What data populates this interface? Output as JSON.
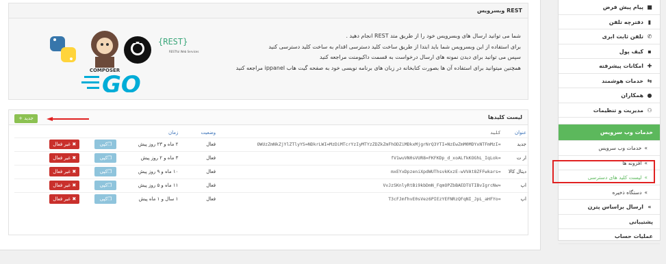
{
  "service_panel": {
    "title": "وبسرویس REST",
    "lines": [
      "شما می توانید ارسال های وبسرویس خود را از طریق متد REST انجام دهید .",
      "برای استفاده از این وبسرویس شما باید ابتدا از طریق ساخت کلید دسترسی اقدام به ساخت کلید دسترسی کنید",
      "سپس می توانید برای دیدن نمونه های ارسال درخواست به قسمت داکیومنت مراجعه کنید",
      "همچنین میتوانید برای استفاده آن ها بصورت کتابخانه در زبان های برنامه نویسی خود به صفحه گیت هاب ippanel مراجعه کنید"
    ],
    "logos": {
      "python": "python-logo",
      "composer": "COMPOSER",
      "github": "github-logo",
      "rest": "{REST}",
      "rest_sub": "RESTful Web Services",
      "go": "GO"
    }
  },
  "keys_panel": {
    "title": "لیست کلیدها",
    "add_label": "جدید",
    "columns": [
      "عنوان",
      "کلید",
      "وضعیت",
      "زمان",
      ""
    ],
    "rows": [
      {
        "name": "جدید",
        "key": "=OWUzZmNkZjYlZTlyYS=NDkrLWI=MzDiMTcrYzIyMTYzZDZkZmFhODZiMDkxMjgrNrQ3YTI=NzEwZmM0MDYxNTFmMzI",
        "status": "فعال",
        "time": "۲ ماه و ۲۳ روز پیش"
      },
      {
        "name": "ار ت",
        "key": "=fV1wuVN0sVUR8=FKFKDp_d_xoALfkKOGhL_IqLok",
        "status": "فعال",
        "time": "۳ ماه و ۲ روز پیش"
      },
      {
        "name": "دیتال کالا",
        "key": "=mxEYxDpzeniXpdWUThsvkKxzE-wVVAt8ZFFwkars",
        "status": "فعال",
        "time": "۱۰ ماه و ۹ روز پیش"
      },
      {
        "name": "اپ",
        "key": "=VvJzSKnlyRtBi9kbDmN_FqmOPZbBAEDTUTIBvIgrcNw",
        "status": "فعال",
        "time": "۱۱ ماه و ۵ روز پیش"
      },
      {
        "name": "اپ",
        "key": "=T3cFJmfhvE0sVez6PIEzYEFNRzQFqNI_JpL_aHFYo",
        "status": "فعال",
        "time": "۱ سال و ۱ ماه پیش"
      }
    ],
    "copy_label": "کپی",
    "disable_label": "غیر فعال"
  },
  "sidebar": {
    "items": [
      {
        "label": "پیام پیش فرض",
        "icon": "book-icon"
      },
      {
        "label": "دفترچه تلفن",
        "icon": "phonebook-icon"
      },
      {
        "label": "تلفن ثابت ابری",
        "icon": "phone-icon"
      },
      {
        "label": "کیف پول",
        "icon": "wallet-icon"
      },
      {
        "label": "امکانات پیشرفته",
        "icon": "puzzle-icon"
      },
      {
        "label": "خدمات هوشمند",
        "icon": "retweet-icon"
      },
      {
        "label": "همکاران",
        "icon": "user-icon"
      },
      {
        "label": "مدیریت و تنظیمات",
        "icon": "users-icon"
      }
    ],
    "active": "خدمات وب سرویس",
    "sub": [
      {
        "label": "خدمات وب سرویس"
      },
      {
        "label": "افزونه ها"
      },
      {
        "label": "لیست کلید های دسترسی"
      },
      {
        "label": "دستگاه ذخیره"
      }
    ],
    "bottom": [
      {
        "label": "ارسال براساس پترن",
        "icon": "chevron-icon"
      },
      {
        "label": "پشتیبانی",
        "icon": ""
      },
      {
        "label": "عملیات حساب",
        "icon": ""
      }
    ]
  },
  "colors": {
    "accent": "#5cb85c",
    "danger": "#c9302c",
    "info": "#8fc4dc",
    "link": "#3b73b9",
    "highlight": "#e02020"
  }
}
